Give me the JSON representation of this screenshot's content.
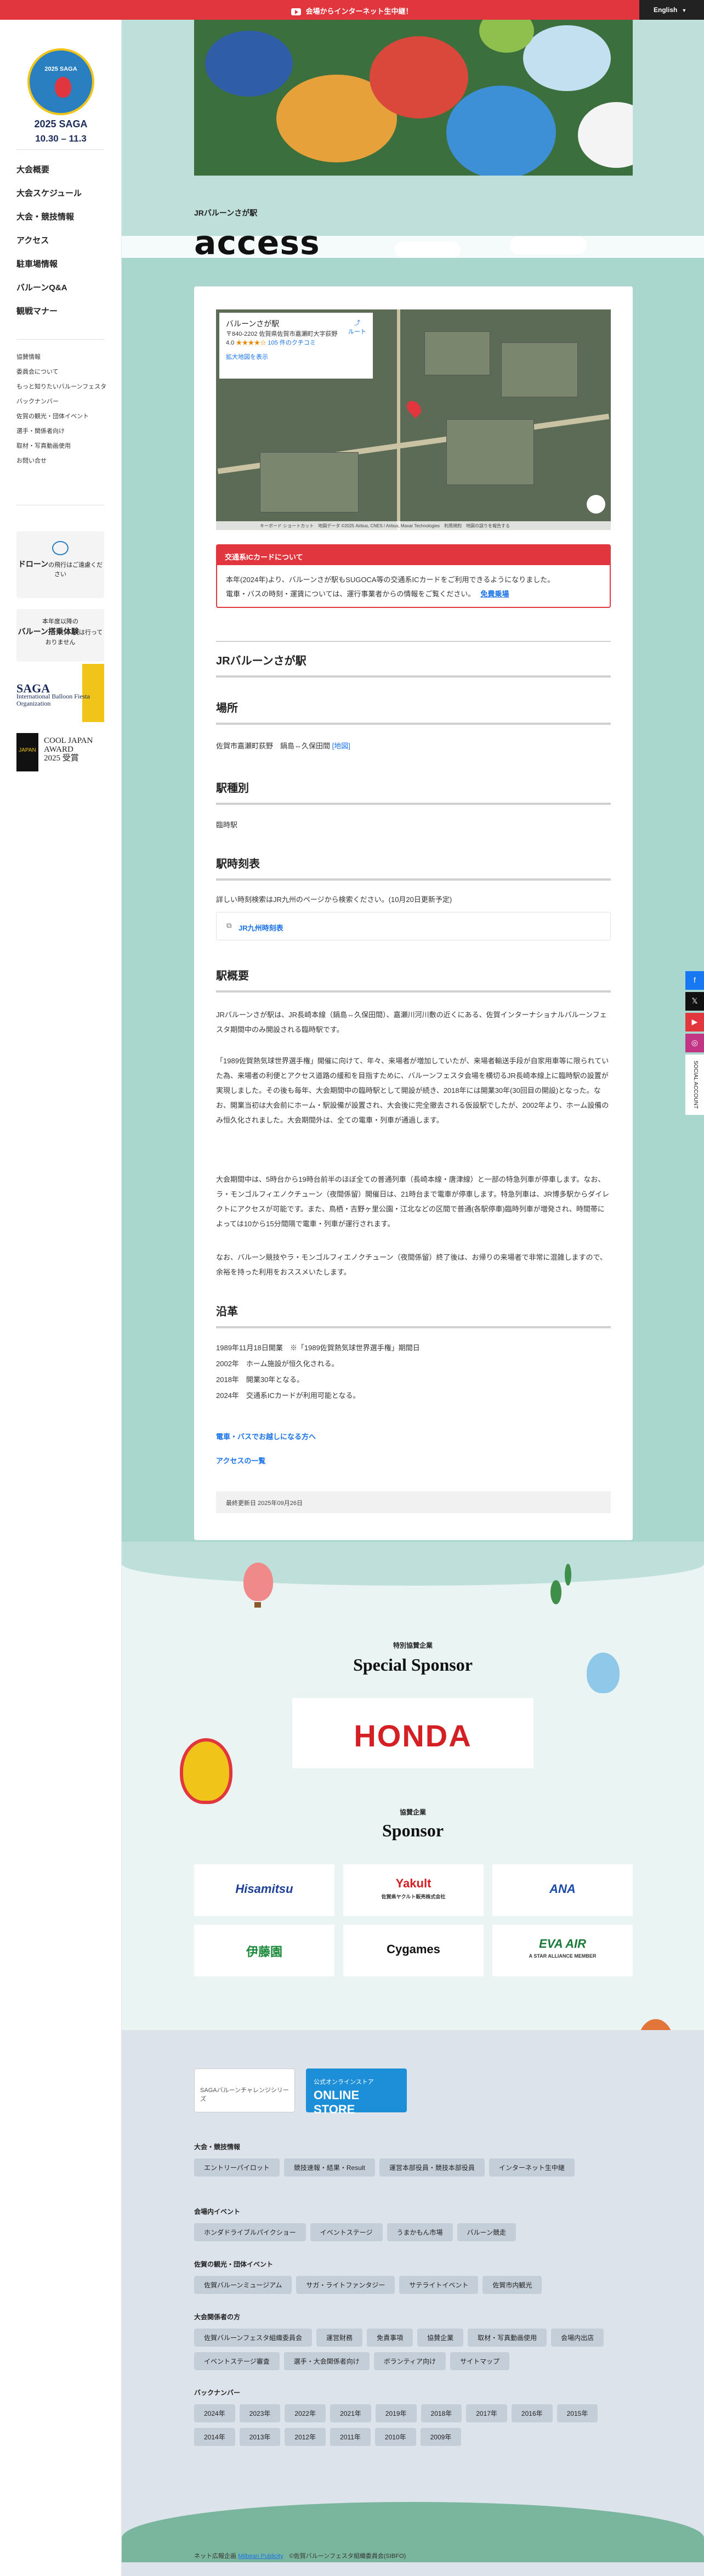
{
  "topbar": {
    "live_label": "会場からインターネット生中継！",
    "lang_label": "English"
  },
  "logo": {
    "name": "2025 SAGA",
    "dates": "10.30 – 11.3"
  },
  "nav": [
    "大会概要",
    "大会スケジュール",
    "大会・競技情報",
    "アクセス",
    "駐車場情報",
    "バルーンQ&A",
    "観戦マナー"
  ],
  "subnav": [
    "協賛情報",
    "委員会について",
    "もっと知りたいバルーンフェスタ",
    "バックナンバー",
    "佐賀の観光・団体イベント",
    "選手・関係者向け",
    "取材・写真動画使用",
    "お問い合せ"
  ],
  "side_boxes": {
    "drone_title": "ドローン",
    "drone_text": "の飛行はご遠慮ください",
    "experience_line1": "本年度以降の",
    "experience_title": "バルーン搭乗体験",
    "experience_line2": "は行っておりません"
  },
  "ibfo": {
    "big": "SAGA",
    "rest": "International Balloon Fiesta Organization"
  },
  "cja": {
    "mark": "JAPAN",
    "line1": "COOL JAPAN",
    "line2": "AWARD",
    "line3": "2025 受賞"
  },
  "breadcrumb": "JRバルーンさが駅",
  "page_title": "access",
  "map": {
    "place": "バルーンさが駅",
    "address": "〒840-2202 佐賀県佐賀市嘉瀬町大字荻野",
    "rating": "4.0",
    "stars": "★★★★☆",
    "reviews": "105 件のクチコミ",
    "route_label": "ルート",
    "enlarge": "拡大地図を表示",
    "footer": "キーボード ショートカット　地図データ ©2025 Airbus, CNES / Airbus, Maxar Technologies　利用規約　地図の誤りを報告する"
  },
  "notice": {
    "head": "交通系ICカードについて",
    "line1": "本年(2024年)より、バルーンさが駅もSUGOCA等の交通系ICカードをご利用できるようになりました。",
    "line2": "電車・バスの時刻・運賃については、運行事業者からの情報をご覧ください。",
    "link": "免費乗場"
  },
  "station_name": "JRバルーンさが駅",
  "sections": {
    "location_h": "場所",
    "location_text": "佐賀市嘉瀬町荻野　鍋島⇔久保田間",
    "location_link": "[地図]",
    "type_h": "駅種別",
    "type_text": "臨時駅",
    "timetable_h": "駅時刻表",
    "timetable_text": "詳しい時刻検索はJR九州のページから検索ください。(10月20日更新予定)",
    "timetable_link": "JR九州時刻表",
    "overview_h": "駅概要",
    "overview_p1": "JRバルーンさが駅は、JR長崎本線（鍋島⇔久保田間）、嘉瀬川河川敷の近くにある、佐賀インターナショナルバルーンフェスタ期間中のみ開設される臨時駅です。",
    "overview_p2": "「1989佐賀熱気球世界選手権」開催に向けて、年々、来場者が増加していたが、来場者輸送手段が自家用車等に限られていた為、来場者の利便とアクセス道路の緩和を目指すために、バルーンフェスタ会場を横切るJR長崎本線上に臨時駅の設置が実現しました。その後も毎年、大会期間中の臨時駅として開設が続き、2018年には開業30年(30回目の開設)となった。なお、開業当初は大会前にホーム・駅設備が設置され、大会後に完全撤去される仮設駅でしたが、2002年より、ホーム設備のみ恒久化されました。大会期間外は、全ての電車・列車が通過します。",
    "overview_p3": "大会期間中は、5時台から19時台前半のほぼ全ての普通列車（長崎本線・唐津線）と一部の特急列車が停車します。なお、ラ・モンゴルフィエノクチューン（夜間係留）開催日は、21時台まで電車が停車します。特急列車は、JR博多駅からダイレクトにアクセスが可能です。また、鳥栖・吉野ヶ里公園・江北などの区間で普通(各駅停車)臨時列車が増発され、時間帯によっては10から15分間隔で電車・列車が運行されます。",
    "overview_p4": "なお、バルーン競技やラ・モンゴルフィエノクチューン（夜間係留）終了後は、お帰りの来場者で非常に混雑しますので、余裕を持った利用をおススメいたします。",
    "history_h": "沿革",
    "history": [
      "1989年11月18日開業　※「1989佐賀熱気球世界選手権」期間日",
      "2002年　ホーム施設が恒久化される。",
      "2018年　開業30年となる。",
      "2024年　交通系ICカードが利用可能となる。"
    ],
    "link1": "電車・バスでお越しになる方へ",
    "link2": "アクセスの一覧",
    "updated": "最終更新日 2025年09月26日"
  },
  "sponsors": {
    "special_label": "特別協賛企業",
    "special_title": "Special Sponsor",
    "honda": "HONDA",
    "label": "協賛企業",
    "title": "Sponsor",
    "logos": [
      "Hisamitsu",
      "Yakult",
      "ANA",
      "伊藤園",
      "Cygames",
      "EVA AIR"
    ],
    "yakult_sub": "佐賀県ヤクルト販売株式会社",
    "eva_sub": "A STAR ALLIANCE MEMBER"
  },
  "footer": {
    "banner1": "SAGAバルーンチャレンジシリーズ",
    "banner2_small": "公式オンラインストア",
    "banner2": "ONLINE STORE",
    "groups": [
      {
        "title": "大会・競技情報",
        "tags": [
          "エントリーパイロット",
          "競技速報・結果・Result",
          "運営本部役員・競技本部役員",
          "インターネット生中継"
        ]
      },
      {
        "title": "会場内イベント",
        "tags": [
          "ホンダドライブルパイクショー",
          "イベントステージ",
          "うまかもん市場",
          "バルーン競走"
        ]
      },
      {
        "title": "佐賀の観光・団体イベント",
        "tags": [
          "佐賀バルーンミュージアム",
          "サガ・ライトファンタジー",
          "サテライトイベント",
          "佐賀市内観光"
        ]
      },
      {
        "title": "大会関係者の方",
        "tags": [
          "佐賀バルーンフェスタ組織委員会",
          "運営財務",
          "免責事項",
          "協賛企業",
          "取材・写真動画使用",
          "会場内出店",
          "イベントステージ審査",
          "選手・大会関係者向け",
          "ボランティア向け",
          "サイトマップ"
        ]
      },
      {
        "title": "バックナンバー",
        "tags": [
          "2024年",
          "2023年",
          "2022年",
          "2021年",
          "2019年",
          "2018年",
          "2017年",
          "2016年",
          "2015年",
          "2014年",
          "2013年",
          "2012年",
          "2011年",
          "2010年",
          "2009年"
        ]
      }
    ],
    "copy_prefix": "ネット広報企画",
    "copy_link": "Milbean Publicity",
    "copy_suffix": "©佐賀バルーンフェスタ組織委員会(SIBFO)"
  },
  "social": {
    "label": "SOCIAL ACCOUNT"
  },
  "colors": {
    "accent": "#e2363f",
    "link": "#1a73e8",
    "navy": "#1a2b5a",
    "sky": "#a9d6cd"
  }
}
